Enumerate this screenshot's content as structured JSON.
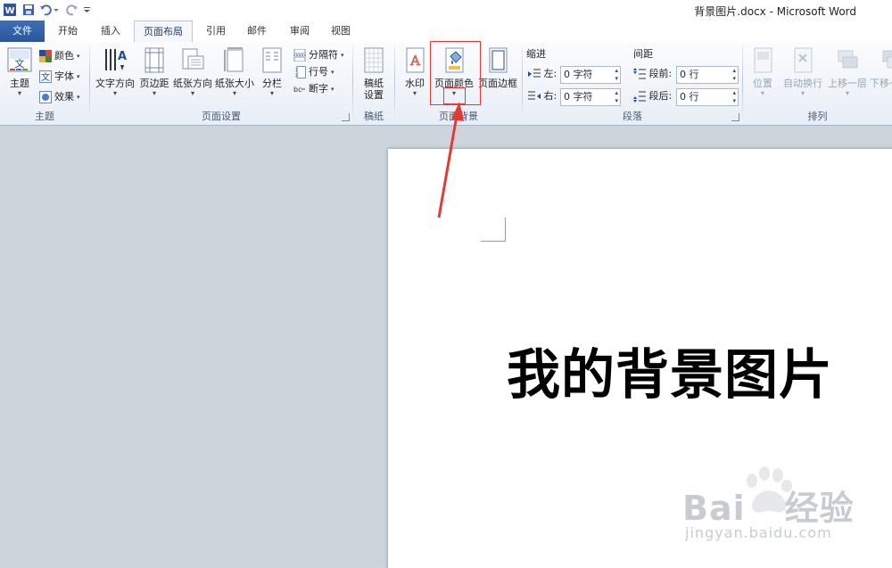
{
  "window": {
    "title": "背景图片.docx - Microsoft Word"
  },
  "tabs": [
    {
      "label": "文件"
    },
    {
      "label": "开始"
    },
    {
      "label": "插入"
    },
    {
      "label": "页面布局"
    },
    {
      "label": "引用"
    },
    {
      "label": "邮件"
    },
    {
      "label": "审阅"
    },
    {
      "label": "视图"
    }
  ],
  "active_tab": "页面布局",
  "groups": {
    "theme": {
      "label": "主题",
      "theme_btn": "主题",
      "colors": "颜色",
      "fonts": "字体",
      "effects": "效果"
    },
    "page_setup": {
      "label": "页面设置",
      "text_direction": "文字方向",
      "margins": "页边距",
      "orientation": "纸张方向",
      "size": "纸张大小",
      "columns": "分栏",
      "breaks": "分隔符",
      "line_numbers": "行号",
      "hyphenation": "断字"
    },
    "manuscript": {
      "label": "稿纸",
      "settings_line1": "稿纸",
      "settings_line2": "设置"
    },
    "page_background": {
      "label": "页面背景",
      "watermark": "水印",
      "page_color": "页面颜色",
      "page_borders": "页面边框"
    },
    "paragraph": {
      "label": "段落",
      "indent_title": "缩进",
      "indent_left_label": "左:",
      "indent_left_value": "0 字符",
      "indent_right_label": "右:",
      "indent_right_value": "0 字符",
      "spacing_title": "间距",
      "spacing_before_label": "段前:",
      "spacing_before_value": "0 行",
      "spacing_after_label": "段后:",
      "spacing_after_value": "0 行"
    },
    "arrange": {
      "label": "排列",
      "position": "位置",
      "wrap_text": "自动换行",
      "bring_forward": "上移一层",
      "send_backward": "下移一"
    }
  },
  "document": {
    "heading": "我的背景图片"
  },
  "watermark": {
    "brand": "Bai",
    "brand2": "经验",
    "url": "jingyan.baidu.com"
  },
  "colors": {
    "file_tab": "#2b579a",
    "annotation_red": "#e53935"
  }
}
